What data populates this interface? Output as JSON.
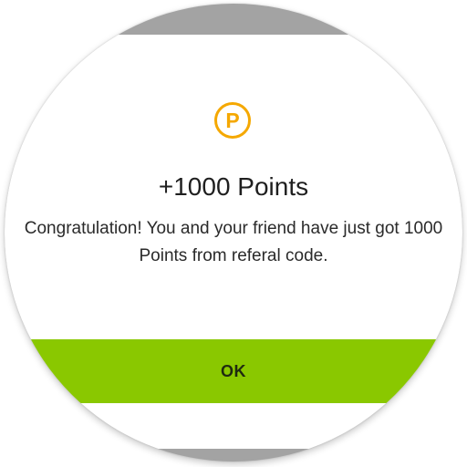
{
  "dialog": {
    "icon": "points-coin-icon",
    "icon_letter": "P",
    "title": "+1000 Points",
    "message": "Congratulation! You and your friend have just got 1000 Points from referal code.",
    "ok_label": "OK"
  },
  "colors": {
    "backdrop": "#a3a3a3",
    "accent_orange": "#f5a800",
    "button_green": "#8ac800",
    "text_dark": "#1f1f1f"
  }
}
